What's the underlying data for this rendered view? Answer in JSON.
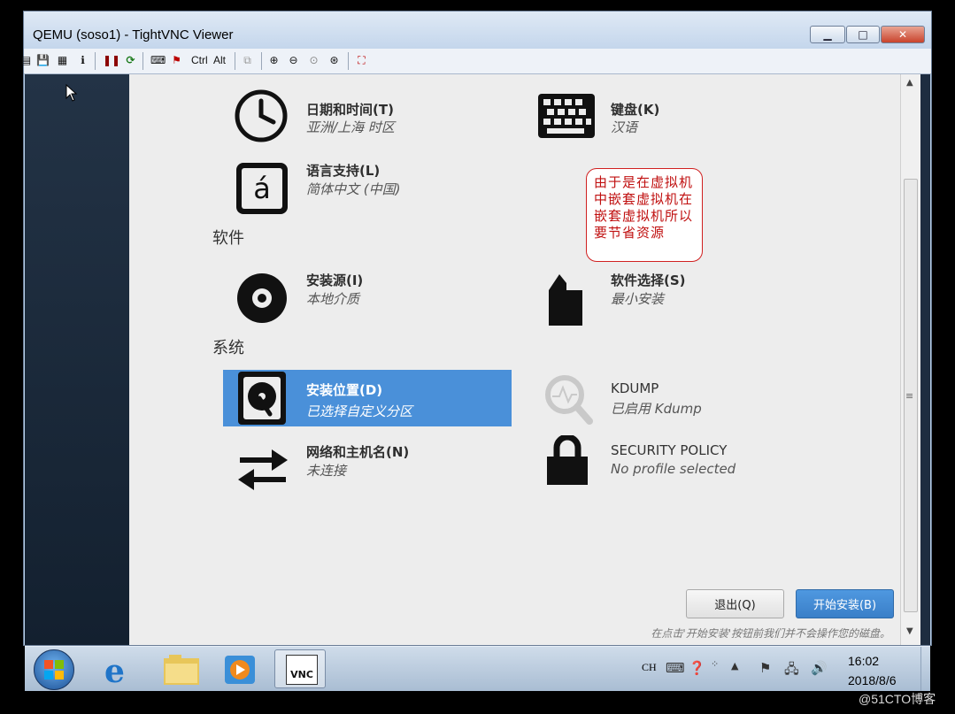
{
  "window": {
    "title": "QEMU (soso1) - TightVNC Viewer",
    "controls": {
      "minimize": "▁",
      "maximize": "□",
      "close": "✕"
    },
    "toolbar_text": {
      "ctrl": "Ctrl",
      "alt": "Alt"
    }
  },
  "installer": {
    "localization": {
      "datetime": {
        "title": "日期和时间(T)",
        "subtitle": "亚洲/上海 时区",
        "icon": "clock-icon"
      },
      "keyboard": {
        "title": "键盘(K)",
        "subtitle": "汉语",
        "icon": "keyboard-icon"
      },
      "language": {
        "title": "语言支持(L)",
        "subtitle": "简体中文 (中国)",
        "icon": "language-icon",
        "glyph": "á"
      }
    },
    "software_section": "软件",
    "software": {
      "source": {
        "title": "安装源(I)",
        "subtitle": "本地介质",
        "icon": "disc-icon"
      },
      "selection": {
        "title": "软件选择(S)",
        "subtitle": "最小安装",
        "icon": "package-icon"
      }
    },
    "system_section": "系统",
    "system": {
      "destination": {
        "title": "安装位置(D)",
        "subtitle": "已选择自定义分区",
        "icon": "harddisk-icon",
        "selected": true
      },
      "kdump": {
        "title": "KDUMP",
        "subtitle": "已启用 Kdump",
        "icon": "magnifier-icon"
      },
      "network": {
        "title": "网络和主机名(N)",
        "subtitle": "未连接",
        "icon": "network-arrows-icon"
      },
      "security": {
        "title": "SECURITY POLICY",
        "subtitle": "No profile selected",
        "icon": "lock-icon"
      }
    },
    "annotation": "由于是在虚拟机中嵌套虚拟机在嵌套虚拟机所以要节省资源",
    "quit_button": "退出(Q)",
    "begin_button": "开始安装(B)",
    "note": "在点击'开始安装'按钮前我们并不会操作您的磁盘。"
  },
  "taskbar": {
    "lang": "CH",
    "time": "16:02",
    "date": "2018/8/6"
  },
  "watermark": "@51CTO博客",
  "colors": {
    "selected": "#4a90d9",
    "annotation_red": "#c01010",
    "begin_button": "#3a7fc8"
  }
}
